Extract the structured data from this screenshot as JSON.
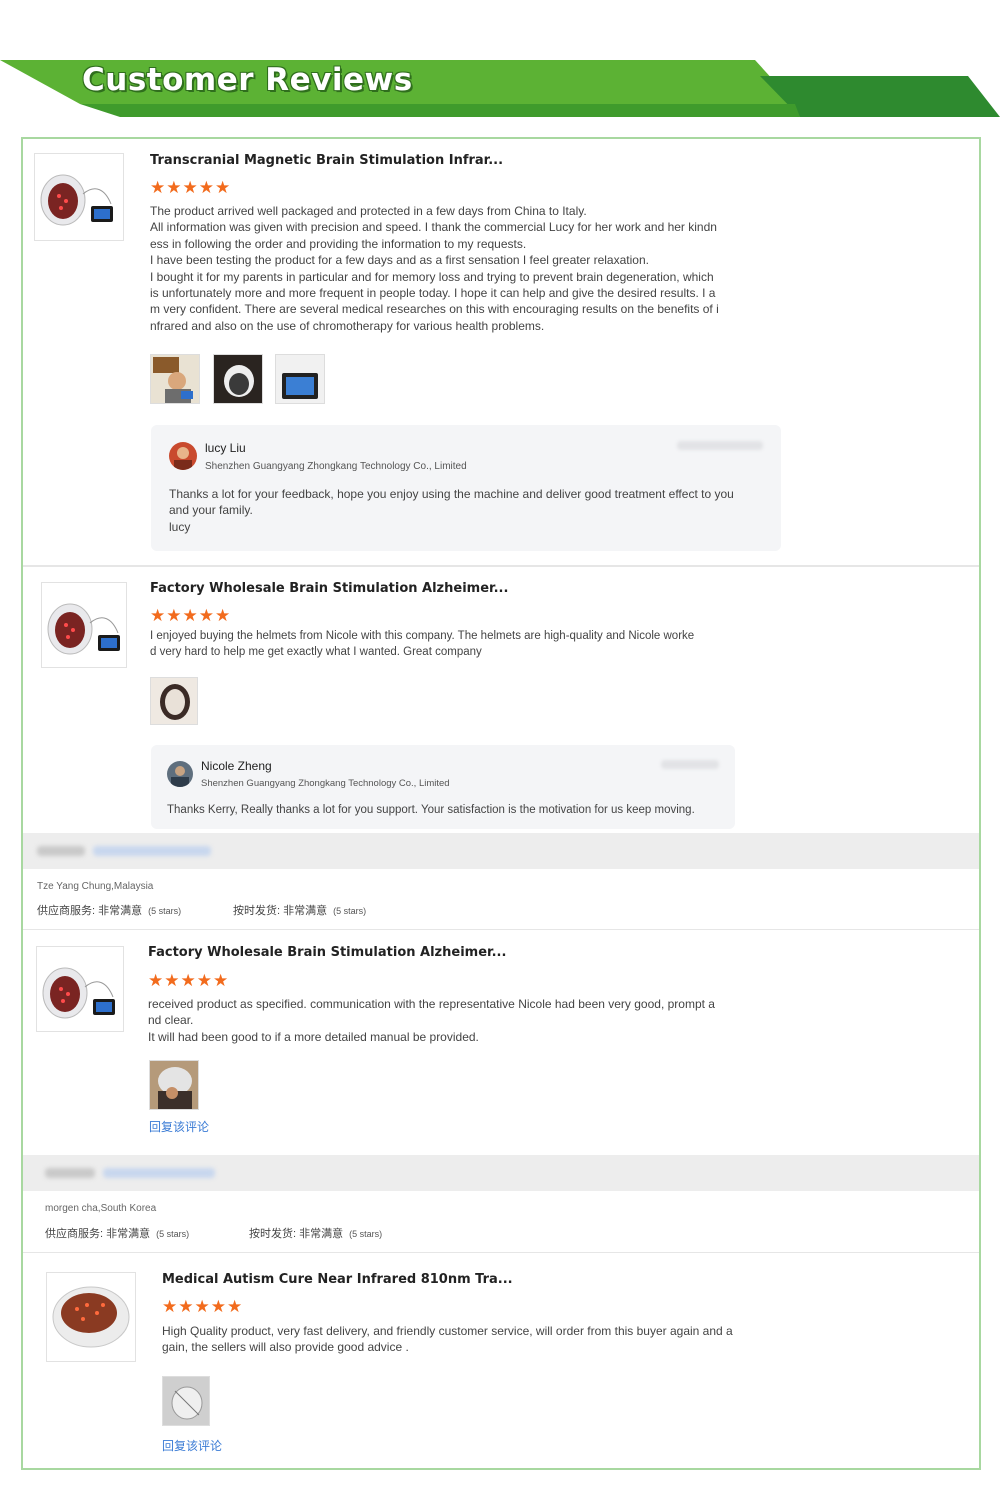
{
  "header": {
    "title": "Customer Reviews"
  },
  "colors": {
    "banner_light": "#5cb234",
    "banner_dark": "#2e8a2f",
    "star": "#f26b1d",
    "link": "#3a7bd5",
    "frame_border": "#a8d8a0"
  },
  "reviews": [
    {
      "product_title": "Transcranial Magnetic Brain Stimulation Infrar...",
      "rating": 5,
      "stars": "★★★★★",
      "text": "The product arrived well packaged and protected in a few days from China to Italy.\nAll information was given with precision and speed. I thank the commercial Lucy for her work and her kindn\ness in following the order and providing the information to my requests.\nI have been testing the product for a few days and as a first sensation I feel greater relaxation.\nI bought it for my parents in particular and for memory loss and trying to prevent brain degeneration, which\nis unfortunately more and more frequent in people today. I hope it can help and give the desired results. I a\nm very confident. There are several medical researches on this with encouraging results on the benefits of i\nnfrared and also on the use of chromotherapy for various health problems.",
      "photo_icons": [
        "person-photo-icon",
        "helmet-photo-icon",
        "device-photo-icon"
      ],
      "reply": {
        "name": "lucy Liu",
        "company": "Shenzhen Guangyang Zhongkang Technology Co., Limited",
        "text": "Thanks a lot for your feedback, hope you enjoy using the machine and deliver good treatment effect to you\nand your family.\nlucy"
      }
    },
    {
      "product_title": "Factory Wholesale Brain Stimulation Alzheimer...",
      "rating": 5,
      "stars": "★★★★★",
      "text": "I enjoyed buying the helmets from Nicole with this company. The helmets are high-quality and Nicole worke\nd very hard to help me get exactly what I wanted. Great company",
      "photo_icons": [
        "helmet-photo-icon"
      ],
      "reply": {
        "name": "Nicole Zheng",
        "company": "Shenzhen Guangyang Zhongkang Technology Co., Limited",
        "text": "Thanks Kerry, Really thanks a lot for you support. Your satisfaction is the motivation for us keep moving."
      }
    },
    {
      "buyer": "Tze Yang Chung,Malaysia",
      "service_label": "供应商服务: 非常满意",
      "service_stars": "(5 stars)",
      "shipping_label": "按时发货: 非常满意",
      "shipping_stars": "(5 stars)",
      "product_title": "Factory Wholesale Brain Stimulation Alzheimer...",
      "rating": 5,
      "stars": "★★★★★",
      "text": "received product as specified. communication with the representative Nicole had been very good, prompt a\nnd clear.\nIt will had been good to if a more detailed manual be provided.",
      "photo_icons": [
        "helmet-wearer-photo-icon"
      ],
      "reply_link": "回复该评论"
    },
    {
      "buyer": "morgen cha,South Korea",
      "service_label": "供应商服务: 非常满意",
      "service_stars": "(5 stars)",
      "shipping_label": "按时发货: 非常满意",
      "shipping_stars": "(5 stars)",
      "product_title": "Medical Autism Cure Near Infrared 810nm Tra...",
      "rating": 5,
      "stars": "★★★★★",
      "text": "High Quality product, very fast delivery, and friendly customer service, will order from this buyer again and a\ngain, the sellers will also provide good advice .",
      "photo_icons": [
        "package-photo-icon"
      ],
      "reply_link": "回复该评论"
    }
  ]
}
